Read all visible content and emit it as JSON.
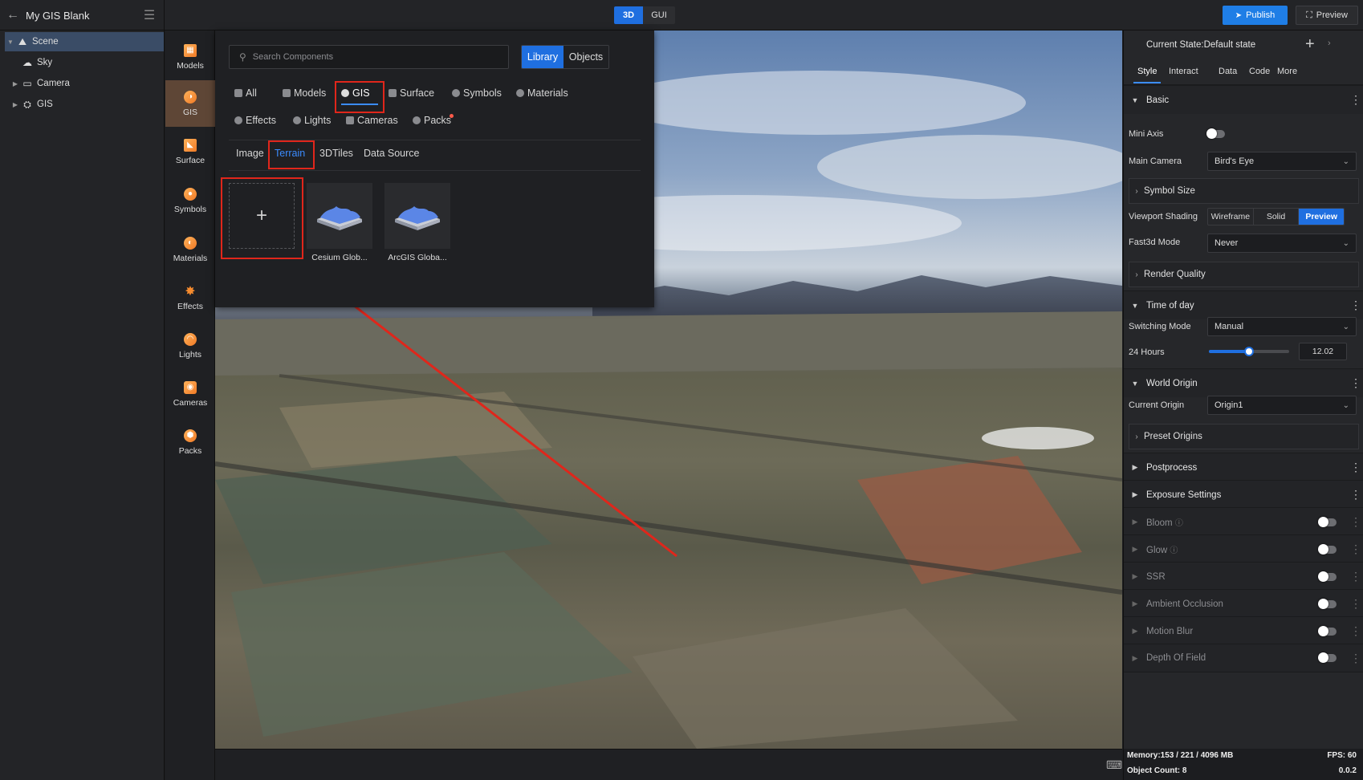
{
  "app": {
    "title": "My GIS Blank",
    "mode_tabs": [
      "3D",
      "GUI"
    ],
    "active_mode": "3D",
    "publish_label": "Publish",
    "preview_label": "Preview"
  },
  "scene_tree": [
    {
      "label": "Scene",
      "icon": "scene-icon",
      "expanded": true,
      "selected": true
    },
    {
      "label": "Sky",
      "icon": "sky-icon"
    },
    {
      "label": "Camera",
      "icon": "folder-icon",
      "collapsed": true
    },
    {
      "label": "GIS",
      "icon": "gis-icon",
      "collapsed": true
    }
  ],
  "component_bar": [
    {
      "label": "Models",
      "icon": "models-icon"
    },
    {
      "label": "GIS",
      "icon": "gis-icon",
      "active": true
    },
    {
      "label": "Surface",
      "icon": "surface-icon"
    },
    {
      "label": "Symbols",
      "icon": "symbols-icon"
    },
    {
      "label": "Materials",
      "icon": "materials-icon"
    },
    {
      "label": "Effects",
      "icon": "effects-icon"
    },
    {
      "label": "Lights",
      "icon": "lights-icon"
    },
    {
      "label": "Cameras",
      "icon": "cameras-icon"
    },
    {
      "label": "Packs",
      "icon": "packs-icon"
    }
  ],
  "library": {
    "search_placeholder": "Search Components",
    "toggle": [
      "Library",
      "Objects"
    ],
    "active_toggle": "Library",
    "categories_row1": [
      "All",
      "Models",
      "GIS",
      "Surface",
      "Symbols",
      "Materials"
    ],
    "categories_row2": [
      "Effects",
      "Lights",
      "Cameras",
      "Packs"
    ],
    "active_category": "GIS",
    "subtabs": [
      "Image",
      "Terrain",
      "3DTiles",
      "Data Source"
    ],
    "active_subtab": "Terrain",
    "add_symbol": "+",
    "items": [
      "Cesium Glob...",
      "ArcGIS Globa..."
    ]
  },
  "right_panel": {
    "state_label": "Current State:Default state",
    "tabs": [
      "Style",
      "Interact",
      "Data",
      "Code",
      "More"
    ],
    "active_tab": "Style",
    "basic_title": "Basic",
    "mini_axis_label": "Mini Axis",
    "main_camera_label": "Main Camera",
    "main_camera_value": "Bird's Eye",
    "symbol_size_label": "Symbol Size",
    "viewport_shading_label": "Viewport Shading",
    "shading_options": [
      "Wireframe",
      "Solid",
      "Preview"
    ],
    "shading_active": "Preview",
    "fast3d_label": "Fast3d Mode",
    "fast3d_value": "Never",
    "render_quality_label": "Render Quality",
    "time_of_day_title": "Time of day",
    "switching_mode_label": "Switching Mode",
    "switching_mode_value": "Manual",
    "hours_label": "24 Hours",
    "hours_value": "12.02",
    "hours_fraction": 0.5,
    "world_origin_title": "World Origin",
    "current_origin_label": "Current Origin",
    "current_origin_value": "Origin1",
    "preset_origins_label": "Preset Origins",
    "postprocess_title": "Postprocess",
    "exposure_title": "Exposure Settings",
    "effects": [
      "Bloom",
      "Glow",
      "SSR",
      "Ambient Occlusion",
      "Motion Blur",
      "Depth Of Field"
    ]
  },
  "status": {
    "memory": "Memory:153 / 221 / 4096 MB",
    "fps": "FPS: 60",
    "object_count": "Object Count: 8",
    "version": "0.0.2"
  },
  "colors": {
    "accent": "#1f6fe0",
    "active_text": "#3b8cff",
    "highlight_box": "#e0261b",
    "component_active": "#5e4636"
  }
}
